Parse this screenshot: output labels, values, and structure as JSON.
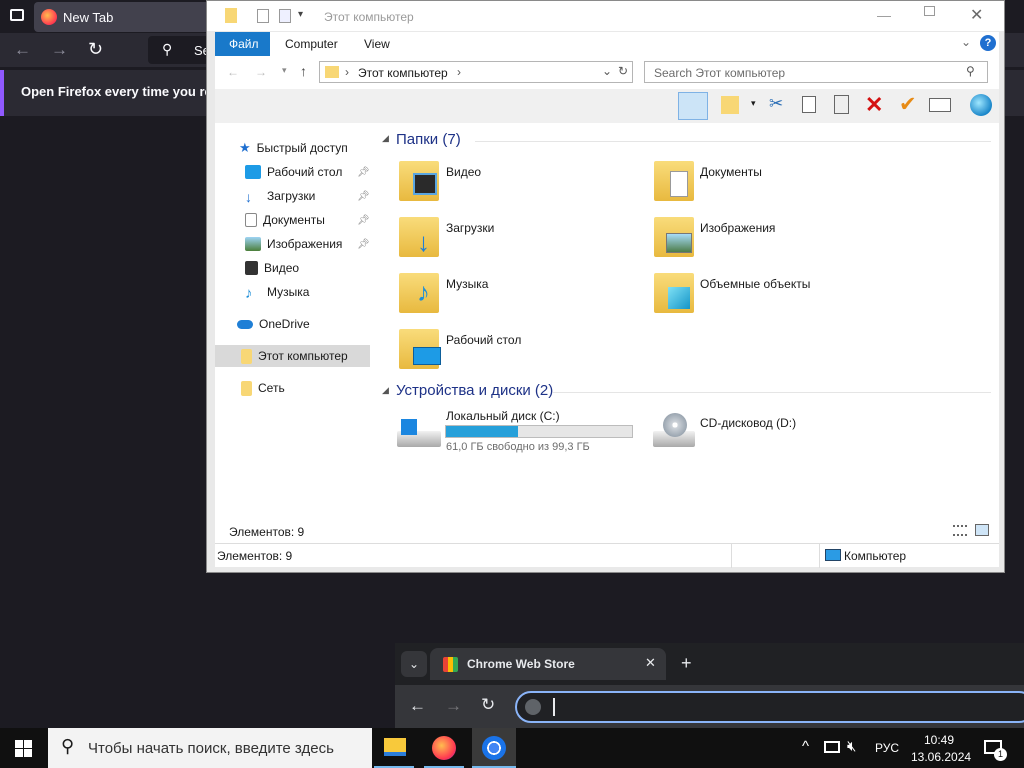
{
  "firefox": {
    "tab_title": "New Tab",
    "search_partial": "Se",
    "notice_text": "Open Firefox every time you rest"
  },
  "explorer": {
    "title": "Этот компьютер",
    "ribbon_tabs": [
      "Файл",
      "Computer",
      "View"
    ],
    "address_path": "Этот компьютер",
    "search_placeholder": "Search Этот компьютер",
    "nav": {
      "quick_access": "Быстрый доступ",
      "items": [
        "Рабочий стол",
        "Загрузки",
        "Документы",
        "Изображения",
        "Видео",
        "Музыка"
      ],
      "onedrive": "OneDrive",
      "this_pc": "Этот компьютер",
      "network": "Сеть"
    },
    "folders_header": "Папки (7)",
    "folders": [
      "Видео",
      "Документы",
      "Загрузки",
      "Изображения",
      "Музыка",
      "Объемные объекты",
      "Рабочий стол"
    ],
    "devices_header": "Устройства и диски (2)",
    "drive_c": {
      "name": "Локальный диск (C:)",
      "free_text": "61,0 ГБ свободно из 99,3 ГБ",
      "used_fraction": 0.386
    },
    "drive_d": {
      "name": "CD-дисковод (D:)"
    },
    "items_count": "Элементов: 9",
    "status_items": "Элементов: 9",
    "status_location": "Компьютер"
  },
  "chrome": {
    "tab_title": "Chrome Web Store"
  },
  "taskbar": {
    "search_placeholder": "Чтобы начать поиск, введите здесь",
    "lang": "РУС",
    "time": "10:49",
    "date": "13.06.2024",
    "notif_count": "1"
  },
  "colors": {
    "accent_firefox": "#9059ff",
    "explorer_link": "#1e3287",
    "drive_bar": "#26a0da",
    "chrome_focus": "#8ab4f8"
  }
}
